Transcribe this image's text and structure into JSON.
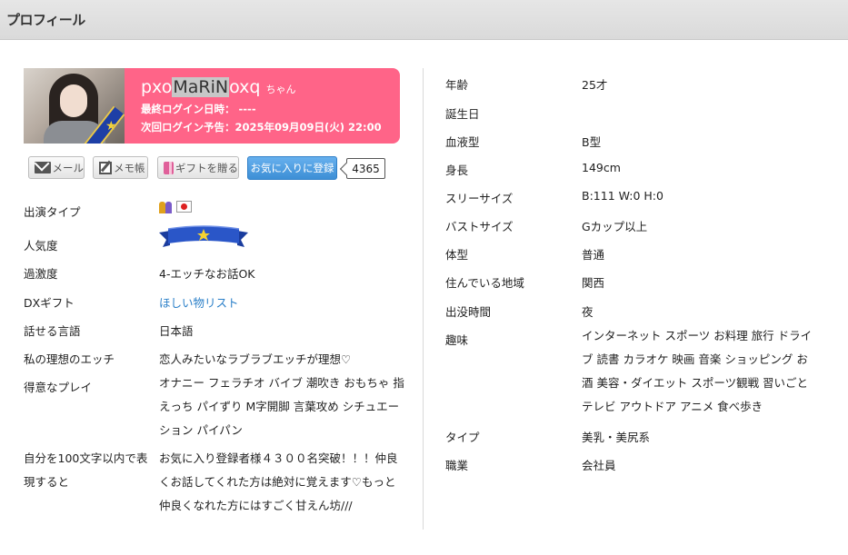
{
  "header": {
    "title": "プロフィール"
  },
  "profile": {
    "name_prefix": "pxo",
    "name_highlight": "MaRiN",
    "name_suffix": "oxq",
    "honorific": "ちゃん",
    "last_login": "最終ログイン日時： ----",
    "next_login": "次回ログイン予告：2025年09月09日(火) 22:00"
  },
  "actions": {
    "mail": "メール",
    "memo": "メモ帳",
    "gift": "ギフトを贈る",
    "favorite": "お気に入りに登録",
    "favorite_count": "4365"
  },
  "left_rows": [
    {
      "label": "出演タイプ",
      "value": ""
    },
    {
      "label": "人気度",
      "value": ""
    },
    {
      "label": "過激度",
      "value": "4-エッチなお話OK"
    },
    {
      "label": "DXギフト",
      "value": "ほしい物リスト"
    },
    {
      "label": "話せる言語",
      "value": "日本語"
    },
    {
      "label": "私の理想のエッチ",
      "value": "恋人みたいなラブラブエッチが理想♡"
    },
    {
      "label": "得意なプレイ",
      "value": "オナニー フェラチオ バイブ 潮吹き おもちゃ 指えっち パイずり M字開脚 言葉攻め シチュエーション パイパン"
    },
    {
      "label": "自分を100文字以内で表現すると",
      "value": "お気に入り登録者様４３００名突破！！！仲良くお話してくれた方は絶対に覚えます♡もっと仲良くなれた方にはすごく甘えん坊///"
    }
  ],
  "right_rows": [
    {
      "label": "年齢",
      "value": "25才"
    },
    {
      "label": "誕生日",
      "value": ""
    },
    {
      "label": "血液型",
      "value": "B型"
    },
    {
      "label": "身長",
      "value": "149cm"
    },
    {
      "label": "スリーサイズ",
      "value": "B:111 W:0 H:0"
    },
    {
      "label": "バストサイズ",
      "value": "Gカップ以上"
    },
    {
      "label": "体型",
      "value": "普通"
    },
    {
      "label": "住んでいる地域",
      "value": "関西"
    },
    {
      "label": "出没時間",
      "value": "夜"
    },
    {
      "label": "趣味",
      "value": "インターネット スポーツ お料理 旅行 ドライブ 読書 カラオケ 映画 音楽 ショッピング お酒 美容・ダイエット スポーツ観戦 習いごと テレビ アウトドア アニメ 食べ歩き"
    },
    {
      "label": "タイプ",
      "value": "美乳・美尻系"
    },
    {
      "label": "職業",
      "value": "会社員"
    }
  ],
  "icons": {
    "appearance_type": [
      "couple-icon",
      "japan-flag-icon"
    ],
    "popularity": "ribbon-star-icon"
  },
  "colors": {
    "card": "#ff6488",
    "favorite_button": "#3d8fd6",
    "link": "#2a7fc8"
  }
}
